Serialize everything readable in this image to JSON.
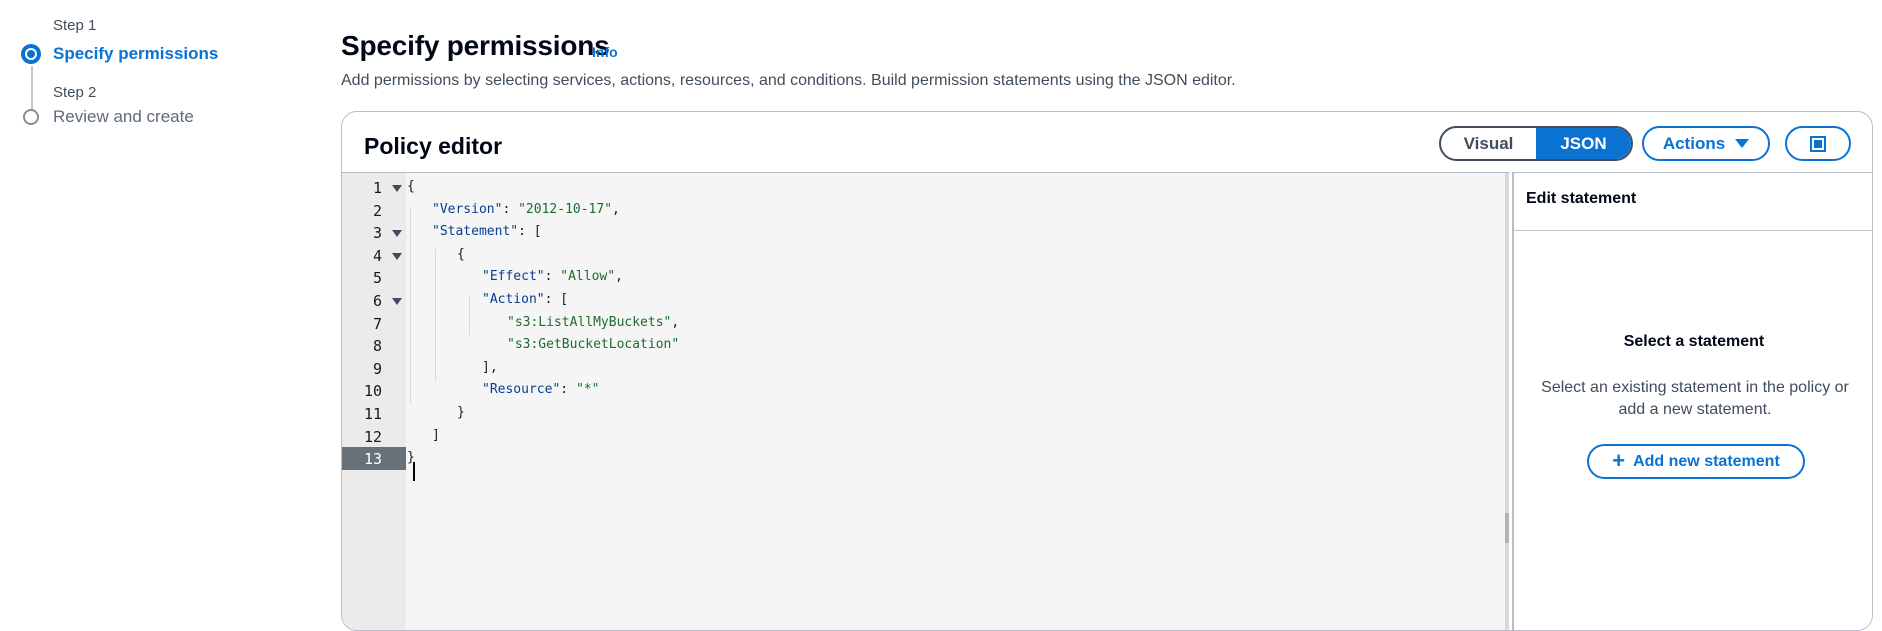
{
  "wizard": {
    "steps": [
      {
        "step_label": "Step 1",
        "title": "Specify permissions",
        "state": "active"
      },
      {
        "step_label": "Step 2",
        "title": "Review and create",
        "state": "inactive"
      }
    ]
  },
  "header": {
    "title": "Specify permissions",
    "info": "Info",
    "description": "Add permissions by selecting services, actions, resources, and conditions. Build permission statements using the JSON editor."
  },
  "policy_editor": {
    "title": "Policy editor",
    "modes": [
      {
        "label": "Visual",
        "selected": false
      },
      {
        "label": "JSON",
        "selected": true
      }
    ],
    "actions_label": "Actions",
    "fullscreen_icon": "fullscreen-icon",
    "active_line": 13,
    "lines": [
      {
        "n": "1",
        "fold": true,
        "text": "{"
      },
      {
        "n": "2",
        "fold": false,
        "key": "\"Version\"",
        "value": "\"2012-10-17\"",
        "tail": ","
      },
      {
        "n": "3",
        "fold": true,
        "key": "\"Statement\"",
        "tail": ": ["
      },
      {
        "n": "4",
        "fold": true,
        "text": "{"
      },
      {
        "n": "5",
        "fold": false,
        "key": "\"Effect\"",
        "value": "\"Allow\"",
        "tail": ","
      },
      {
        "n": "6",
        "fold": true,
        "key": "\"Action\"",
        "tail": ": ["
      },
      {
        "n": "7",
        "fold": false,
        "value_only": "\"s3:ListAllMyBuckets\"",
        "tail": ","
      },
      {
        "n": "8",
        "fold": false,
        "value_only": "\"s3:GetBucketLocation\"",
        "tail": ""
      },
      {
        "n": "9",
        "fold": false,
        "text": "],"
      },
      {
        "n": "10",
        "fold": false,
        "key": "\"Resource\"",
        "value": "\"*\"",
        "tail": ""
      },
      {
        "n": "11",
        "fold": false,
        "text": "}"
      },
      {
        "n": "12",
        "fold": false,
        "text": "]"
      },
      {
        "n": "13",
        "fold": false,
        "text": "}"
      }
    ]
  },
  "edit_statement": {
    "title": "Edit statement",
    "heading": "Select a statement",
    "text": "Select an existing statement in the policy or add a new statement.",
    "add_label": "Add new statement"
  },
  "colors": {
    "accent": "#0972d3",
    "json_key": "#0a3d91",
    "json_string": "#1d6b2f",
    "active_line_bg": "#687078"
  }
}
